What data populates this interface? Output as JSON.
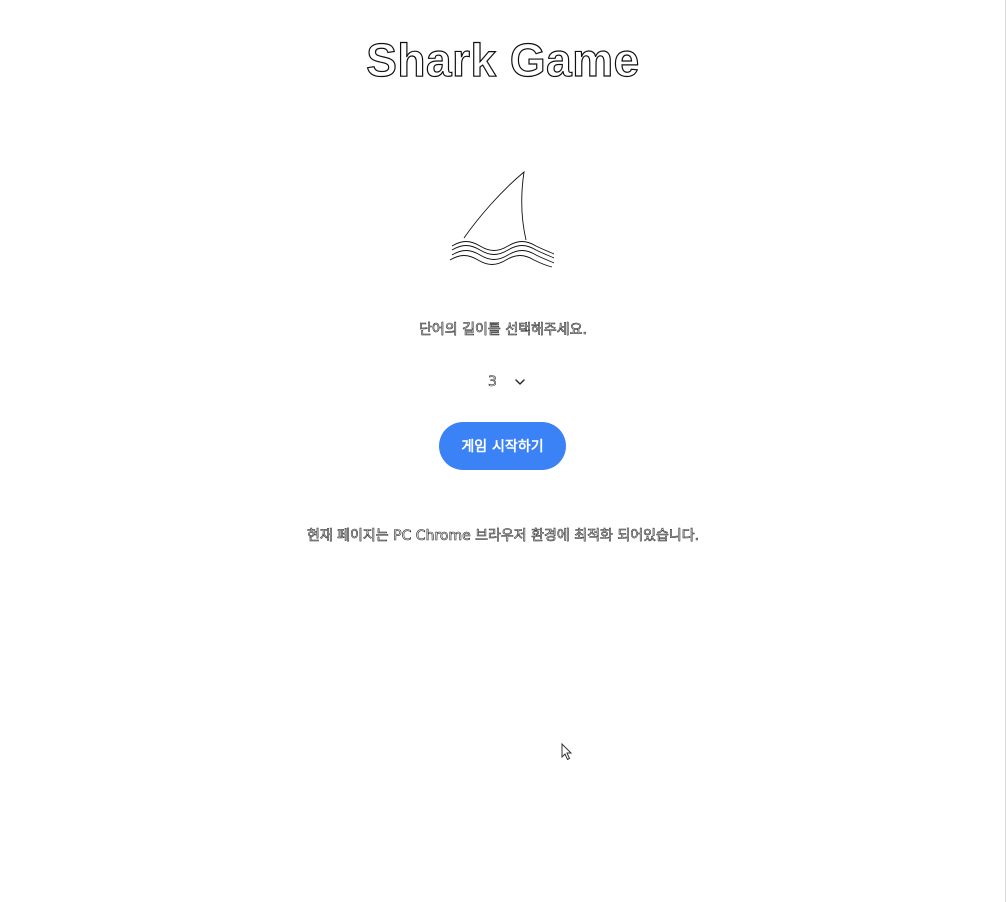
{
  "header": {
    "title": "Shark Game"
  },
  "main": {
    "prompt": "단어의 길이를 선택해주세요.",
    "length_select": {
      "selected": "3"
    },
    "start_button_label": "게임 시작하기",
    "notice": "현재 페이지는 PC Chrome 브라우저 환경에 최적화 되어있습니다."
  },
  "icons": {
    "logo": "shark-fin-icon",
    "dropdown": "chevron-down-icon",
    "pointer": "mouse-cursor-icon"
  },
  "colors": {
    "accent": "#3b82f6",
    "background": "#ffffff",
    "outline": "#111111"
  }
}
